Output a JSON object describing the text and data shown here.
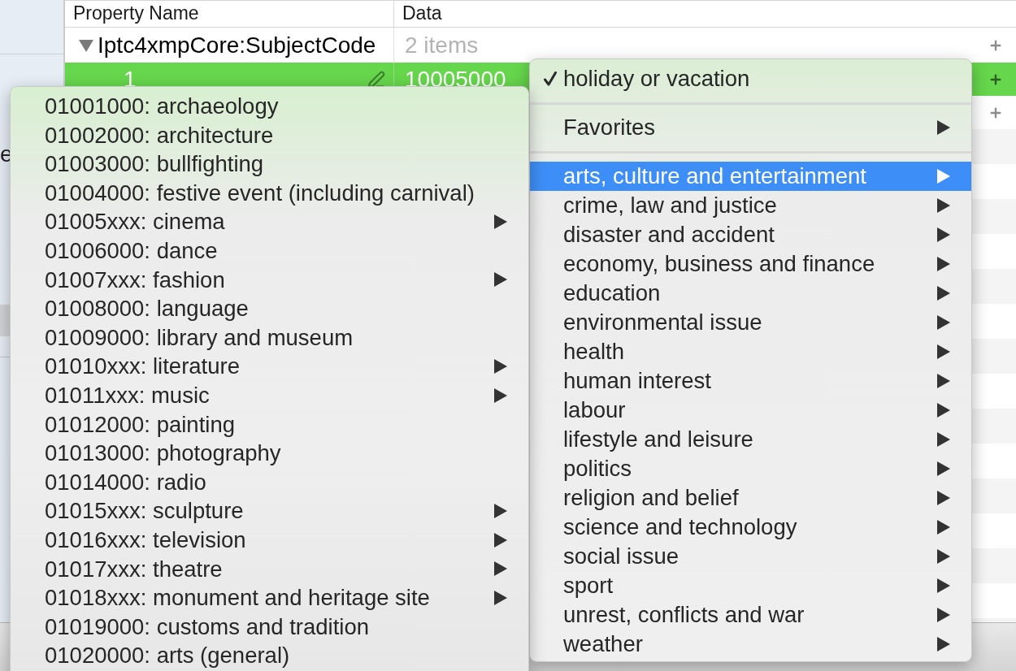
{
  "sidebar": {
    "labels": [
      "e"
    ]
  },
  "table": {
    "columns": [
      "Property Name",
      "Data"
    ],
    "rows": [
      {
        "kind": "group",
        "name": "Iptc4xmpCore:SubjectCode",
        "value": "2 items",
        "expanded": true,
        "selected": false
      },
      {
        "kind": "item",
        "name": "1",
        "value": "10005000",
        "selected": true
      },
      {
        "kind": "item",
        "selected": false
      }
    ]
  },
  "menu": {
    "items": [
      {
        "kind": "item",
        "label": "holiday or vacation",
        "checked": true,
        "submenu": false,
        "selected": false
      },
      {
        "kind": "separator"
      },
      {
        "kind": "item",
        "label": "Favorites",
        "checked": false,
        "submenu": true,
        "selected": false
      },
      {
        "kind": "separator"
      },
      {
        "kind": "item",
        "label": "arts, culture and entertainment",
        "checked": false,
        "submenu": true,
        "selected": true
      },
      {
        "kind": "item",
        "label": "crime, law and justice",
        "checked": false,
        "submenu": true,
        "selected": false
      },
      {
        "kind": "item",
        "label": "disaster and accident",
        "checked": false,
        "submenu": true,
        "selected": false
      },
      {
        "kind": "item",
        "label": "economy, business and finance",
        "checked": false,
        "submenu": true,
        "selected": false
      },
      {
        "kind": "item",
        "label": "education",
        "checked": false,
        "submenu": true,
        "selected": false
      },
      {
        "kind": "item",
        "label": "environmental issue",
        "checked": false,
        "submenu": true,
        "selected": false
      },
      {
        "kind": "item",
        "label": "health",
        "checked": false,
        "submenu": true,
        "selected": false
      },
      {
        "kind": "item",
        "label": "human interest",
        "checked": false,
        "submenu": true,
        "selected": false
      },
      {
        "kind": "item",
        "label": "labour",
        "checked": false,
        "submenu": true,
        "selected": false
      },
      {
        "kind": "item",
        "label": "lifestyle and leisure",
        "checked": false,
        "submenu": true,
        "selected": false
      },
      {
        "kind": "item",
        "label": "politics",
        "checked": false,
        "submenu": true,
        "selected": false
      },
      {
        "kind": "item",
        "label": "religion and belief",
        "checked": false,
        "submenu": true,
        "selected": false
      },
      {
        "kind": "item",
        "label": "science and technology",
        "checked": false,
        "submenu": true,
        "selected": false
      },
      {
        "kind": "item",
        "label": "social issue",
        "checked": false,
        "submenu": true,
        "selected": false
      },
      {
        "kind": "item",
        "label": "sport",
        "checked": false,
        "submenu": true,
        "selected": false
      },
      {
        "kind": "item",
        "label": "unrest, conflicts and war",
        "checked": false,
        "submenu": true,
        "selected": false
      },
      {
        "kind": "item",
        "label": "weather",
        "checked": false,
        "submenu": true,
        "selected": false
      }
    ]
  },
  "submenu": {
    "items": [
      {
        "kind": "item",
        "label": "01001000: archaeology",
        "submenu": false,
        "selected": false
      },
      {
        "kind": "item",
        "label": "01002000: architecture",
        "submenu": false,
        "selected": false
      },
      {
        "kind": "item",
        "label": "01003000: bullfighting",
        "submenu": false,
        "selected": false
      },
      {
        "kind": "item",
        "label": "01004000: festive event (including carnival)",
        "submenu": false,
        "selected": false
      },
      {
        "kind": "item",
        "label": "01005xxx: cinema",
        "submenu": true,
        "selected": false
      },
      {
        "kind": "item",
        "label": "01006000: dance",
        "submenu": false,
        "selected": false
      },
      {
        "kind": "item",
        "label": "01007xxx: fashion",
        "submenu": true,
        "selected": false
      },
      {
        "kind": "item",
        "label": "01008000: language",
        "submenu": false,
        "selected": false
      },
      {
        "kind": "item",
        "label": "01009000: library and museum",
        "submenu": false,
        "selected": false
      },
      {
        "kind": "item",
        "label": "01010xxx: literature",
        "submenu": true,
        "selected": false
      },
      {
        "kind": "item",
        "label": "01011xxx: music",
        "submenu": true,
        "selected": false
      },
      {
        "kind": "item",
        "label": "01012000: painting",
        "submenu": false,
        "selected": false
      },
      {
        "kind": "item",
        "label": "01013000: photography",
        "submenu": false,
        "selected": false
      },
      {
        "kind": "item",
        "label": "01014000: radio",
        "submenu": false,
        "selected": false
      },
      {
        "kind": "item",
        "label": "01015xxx: sculpture",
        "submenu": true,
        "selected": false
      },
      {
        "kind": "item",
        "label": "01016xxx: television",
        "submenu": true,
        "selected": false
      },
      {
        "kind": "item",
        "label": "01017xxx: theatre",
        "submenu": true,
        "selected": false
      },
      {
        "kind": "item",
        "label": "01018xxx: monument and heritage site",
        "submenu": true,
        "selected": false
      },
      {
        "kind": "item",
        "label": "01019000: customs and tradition",
        "submenu": false,
        "selected": false
      },
      {
        "kind": "item",
        "label": "01020000: arts (general)",
        "submenu": false,
        "selected": false
      }
    ]
  }
}
